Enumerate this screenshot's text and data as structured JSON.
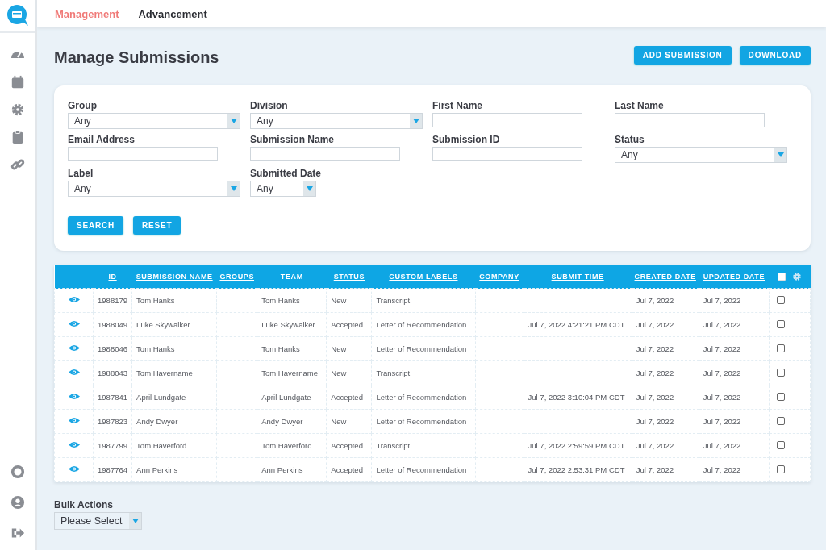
{
  "top_tabs": [
    {
      "label": "Management",
      "selected": true
    },
    {
      "label": "Advancement",
      "selected": false
    }
  ],
  "page_title": "Manage Submissions",
  "header_buttons": [
    "ADD SUBMISSION",
    "DOWNLOAD"
  ],
  "filters": [
    {
      "label": "Group",
      "kind": "select",
      "value": "Any"
    },
    {
      "label": "Division",
      "kind": "select",
      "value": "Any"
    },
    {
      "label": "First Name",
      "kind": "text"
    },
    {
      "label": "Last Name",
      "kind": "text"
    },
    {
      "label": "Email Address",
      "kind": "text"
    },
    {
      "label": "Submission Name",
      "kind": "text"
    },
    {
      "label": "Submission ID",
      "kind": "text"
    },
    {
      "label": "Status",
      "kind": "select",
      "value": "Any"
    },
    {
      "label": "Label",
      "kind": "select",
      "value": "Any"
    },
    {
      "label": "Submitted Date",
      "kind": "short-select",
      "value": "Any"
    }
  ],
  "filter_buttons": [
    "SEARCH",
    "RESET"
  ],
  "table": {
    "columns": [
      {
        "label": "ID",
        "sortable": true
      },
      {
        "label": "SUBMISSION NAME",
        "sortable": true
      },
      {
        "label": "GROUPS",
        "sortable": true
      },
      {
        "label": "TEAM",
        "sortable": false
      },
      {
        "label": "STATUS",
        "sortable": true
      },
      {
        "label": "CUSTOM LABELS",
        "sortable": true
      },
      {
        "label": "COMPANY",
        "sortable": true
      },
      {
        "label": "SUBMIT TIME",
        "sortable": true
      },
      {
        "label": "CREATED DATE",
        "sortable": true
      },
      {
        "label": "UPDATED DATE",
        "sortable": true
      }
    ],
    "select_all_checked": false,
    "rows": [
      {
        "cells": [
          "1988179",
          "Tom Hanks",
          "",
          "Tom Hanks",
          "New",
          "Transcript",
          "",
          "",
          "Jul 7, 2022",
          "Jul 7, 2022"
        ],
        "checked": false
      },
      {
        "cells": [
          "1988049",
          "Luke Skywalker",
          "",
          "Luke Skywalker",
          "Accepted",
          "Letter of Recommendation",
          "",
          "Jul 7, 2022 4:21:21 PM CDT",
          "Jul 7, 2022",
          "Jul 7, 2022"
        ],
        "checked": false
      },
      {
        "cells": [
          "1988046",
          "Tom Hanks",
          "",
          "Tom Hanks",
          "New",
          "Letter of Recommendation",
          "",
          "",
          "Jul 7, 2022",
          "Jul 7, 2022"
        ],
        "checked": false
      },
      {
        "cells": [
          "1988043",
          "Tom Havername",
          "",
          "Tom Havername",
          "New",
          "Transcript",
          "",
          "",
          "Jul 7, 2022",
          "Jul 7, 2022"
        ],
        "checked": false
      },
      {
        "cells": [
          "1987841",
          "April Lundgate",
          "",
          "April Lundgate",
          "Accepted",
          "Letter of Recommendation",
          "",
          "Jul 7, 2022 3:10:04 PM CDT",
          "Jul 7, 2022",
          "Jul 7, 2022"
        ],
        "checked": false
      },
      {
        "cells": [
          "1987823",
          "Andy Dwyer",
          "",
          "Andy Dwyer",
          "New",
          "Letter of Recommendation",
          "",
          "",
          "Jul 7, 2022",
          "Jul 7, 2022"
        ],
        "checked": false
      },
      {
        "cells": [
          "1987799",
          "Tom Haverford",
          "",
          "Tom Haverford",
          "Accepted",
          "Transcript",
          "",
          "Jul 7, 2022 2:59:59 PM CDT",
          "Jul 7, 2022",
          "Jul 7, 2022"
        ],
        "checked": false
      },
      {
        "cells": [
          "1987764",
          "Ann Perkins",
          "",
          "Ann Perkins",
          "Accepted",
          "Letter of Recommendation",
          "",
          "Jul 7, 2022 2:53:31 PM CDT",
          "Jul 7, 2022",
          "Jul 7, 2022"
        ],
        "checked": false
      }
    ]
  },
  "bulk_actions": {
    "label": "Bulk Actions",
    "value": "Please Select"
  }
}
